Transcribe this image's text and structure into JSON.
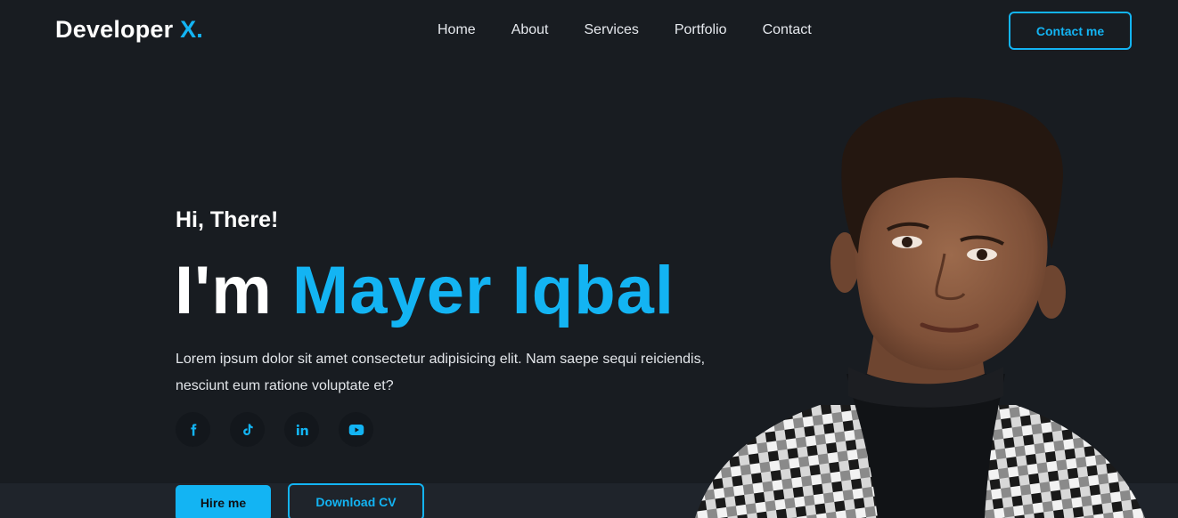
{
  "header": {
    "logo_text": "Developer",
    "logo_accent": "X.",
    "nav": [
      "Home",
      "About",
      "Services",
      "Portfolio",
      "Contact"
    ],
    "contact_button": "Contact me"
  },
  "hero": {
    "greeting": "Hi, There!",
    "title_prefix": "I'm",
    "title_name": "Mayer Iqbal",
    "description": "Lorem ipsum dolor sit amet consectetur adipisicing elit. Nam saepe sequi reiciendis, nesciunt eum ratione voluptate et?",
    "socials": [
      "facebook-icon",
      "tiktok-icon",
      "linkedin-icon",
      "youtube-icon"
    ],
    "hire_button": "Hire me",
    "cv_button": "Download CV"
  },
  "colors": {
    "accent": "#13b4f3",
    "background": "#181c21",
    "text": "#ffffff"
  }
}
